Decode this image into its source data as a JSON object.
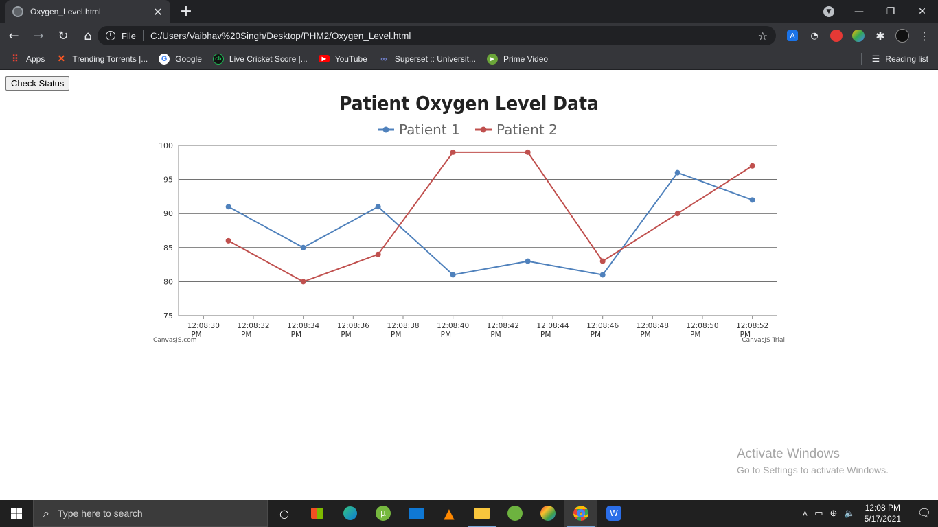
{
  "browser": {
    "tab_title": "Oxygen_Level.html",
    "omnibox": {
      "scheme": "File",
      "url": "C:/Users/Vaibhav%20Singh/Desktop/PHM2/Oxygen_Level.html"
    },
    "bookmarks": [
      {
        "label": "Apps",
        "icon": "apps-grid-icon",
        "color": "#ea4335"
      },
      {
        "label": "Trending Torrents |...",
        "icon": "x-logo-icon",
        "color": "#ff5722"
      },
      {
        "label": "Google",
        "icon": "google-icon",
        "color": "#4285f4"
      },
      {
        "label": "Live Cricket Score |...",
        "icon": "cricket-icon",
        "color": "#1db954"
      },
      {
        "label": "YouTube",
        "icon": "youtube-icon",
        "color": "#ff0000"
      },
      {
        "label": "Superset :: Universit...",
        "icon": "superset-icon",
        "color": "#6f7ec8"
      },
      {
        "label": "Prime Video",
        "icon": "play-icon",
        "color": "#6ba539"
      }
    ],
    "reading_list": "Reading list"
  },
  "page": {
    "check_button": "Check Status"
  },
  "chart_data": {
    "type": "line",
    "title": "Patient Oxygen Level Data",
    "x_ticks": [
      "12:08:30 PM",
      "12:08:32 PM",
      "12:08:34 PM",
      "12:08:36 PM",
      "12:08:38 PM",
      "12:08:40 PM",
      "12:08:42 PM",
      "12:08:44 PM",
      "12:08:46 PM",
      "12:08:48 PM",
      "12:08:50 PM",
      "12:08:52 PM"
    ],
    "x_times": [
      "12:08:31 PM",
      "12:08:34 PM",
      "12:08:37 PM",
      "12:08:40 PM",
      "12:08:43 PM",
      "12:08:46 PM",
      "12:08:49 PM",
      "12:08:52 PM"
    ],
    "xlim": [
      "12:08:29 PM",
      "12:08:53 PM"
    ],
    "ylim": [
      75,
      100
    ],
    "y_ticks": [
      75,
      80,
      85,
      90,
      95,
      100
    ],
    "series": [
      {
        "name": "Patient 1",
        "color": "#4f81bc",
        "values": [
          91,
          85,
          91,
          81,
          83,
          81,
          96,
          92
        ]
      },
      {
        "name": "Patient 2",
        "color": "#c0504e",
        "values": [
          86,
          80,
          84,
          99,
          99,
          83,
          90,
          97
        ]
      }
    ],
    "grid": true,
    "legend": "top",
    "credit_left": "CanvasJS.com",
    "credit_right": "CanvasJS Trial"
  },
  "watermark": {
    "line1": "Activate Windows",
    "line2": "Go to Settings to activate Windows."
  },
  "taskbar": {
    "search_placeholder": "Type here to search",
    "time": "12:08 PM",
    "date": "5/17/2021"
  }
}
